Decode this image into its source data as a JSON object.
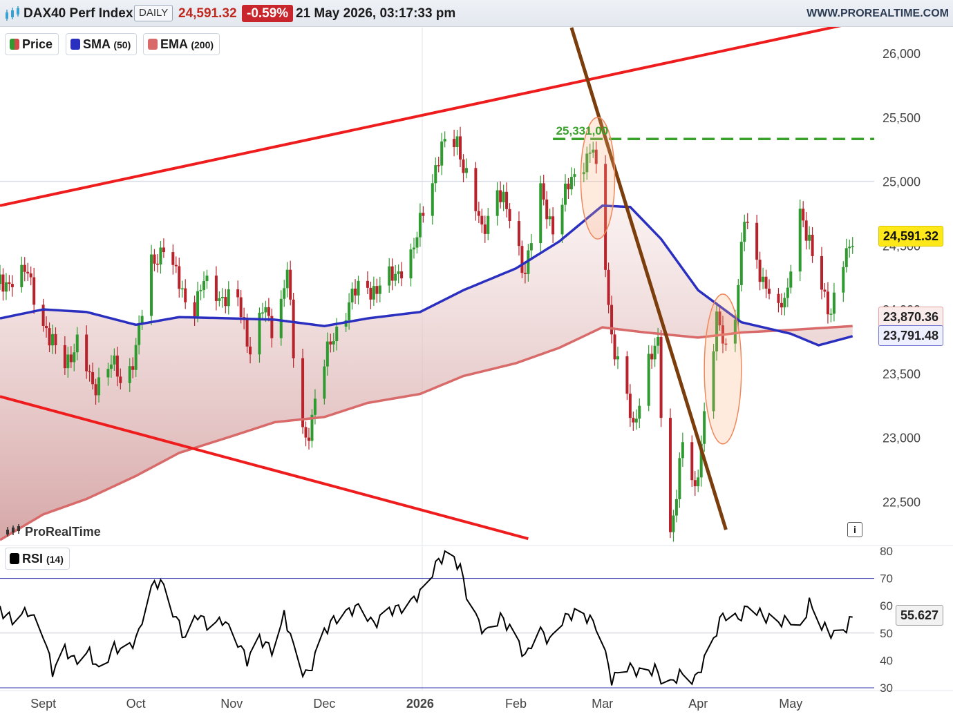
{
  "header": {
    "ticker": "DAX40 Perf Index",
    "timeframe": "DAILY",
    "last_price": "24,591.32",
    "change": "-0.59%",
    "datetime": "21 May 2026, 03:17:33 pm",
    "site": "WWW.PROREALTIME.COM"
  },
  "legend": {
    "price": "Price",
    "sma": "SMA",
    "sma_period": "(50)",
    "ema": "EMA",
    "ema_period": "(200)",
    "rsi": "RSI",
    "rsi_period": "(14)"
  },
  "brand": "ProRealTime",
  "info_label": "i",
  "price_tags": {
    "last": "24,591.32",
    "ema": "23,870.36",
    "sma": "23,791.48",
    "rsi": "55.627",
    "resistance": "25,331,00"
  },
  "colors": {
    "up": "#2f9a2f",
    "down": "#b8222a",
    "sma": "#2a2fbf",
    "ema": "#d86a6a",
    "trend_red": "#ee1c1c",
    "trend_brown": "#7a3d0b",
    "resistance": "#3aa02c",
    "highlight": "#ffb07a",
    "rsi_line": "#000000",
    "rsi_band": "#3a3fb0"
  },
  "chart_data": [
    {
      "type": "candlestick",
      "title": "DAX40 Perf Index",
      "y_ticks": [
        "22,500",
        "23,000",
        "23,500",
        "24,000",
        "24,500",
        "25,000",
        "25,500",
        "26,000"
      ],
      "y_tick_values": [
        22500,
        23000,
        23500,
        24000,
        24500,
        25000,
        25500,
        26000
      ],
      "ylim": [
        22200,
        26200
      ],
      "x_ticks": [
        "Sept",
        "Oct",
        "Nov",
        "Dec",
        "2026",
        "Feb",
        "Mar",
        "Apr",
        "May"
      ],
      "x_tick_dates": [
        "2025-09-01",
        "2025-10-01",
        "2025-11-01",
        "2025-12-01",
        "2026-01-01",
        "2026-02-01",
        "2026-03-01",
        "2026-04-01",
        "2026-05-01"
      ],
      "x_range": [
        "2025-08-18",
        "2026-05-28"
      ],
      "close_path": [
        [
          "2025-08-18",
          24200
        ],
        [
          "2025-08-27",
          24280
        ],
        [
          "2025-09-03",
          23750
        ],
        [
          "2025-09-08",
          23600
        ],
        [
          "2025-09-12",
          23720
        ],
        [
          "2025-09-17",
          23400
        ],
        [
          "2025-09-23",
          23580
        ],
        [
          "2025-09-27",
          23400
        ],
        [
          "2025-10-01",
          23700
        ],
        [
          "2025-10-06",
          24350
        ],
        [
          "2025-10-10",
          24500
        ],
        [
          "2025-10-14",
          24250
        ],
        [
          "2025-10-19",
          23980
        ],
        [
          "2025-10-23",
          24200
        ],
        [
          "2025-10-29",
          24100
        ],
        [
          "2025-11-03",
          24050
        ],
        [
          "2025-11-07",
          23700
        ],
        [
          "2025-11-11",
          24000
        ],
        [
          "2025-11-15",
          23800
        ],
        [
          "2025-11-19",
          24350
        ],
        [
          "2025-11-22",
          23250
        ],
        [
          "2025-11-25",
          22970
        ],
        [
          "2025-11-30",
          23500
        ],
        [
          "2025-12-04",
          23800
        ],
        [
          "2025-12-09",
          24050
        ],
        [
          "2025-12-13",
          24200
        ],
        [
          "2025-12-18",
          24150
        ],
        [
          "2025-12-24",
          24280
        ],
        [
          "2025-12-30",
          24450
        ],
        [
          "2026-01-03",
          24900
        ],
        [
          "2026-01-08",
          25250
        ],
        [
          "2026-01-13",
          25320
        ],
        [
          "2026-01-17",
          24950
        ],
        [
          "2026-01-21",
          24600
        ],
        [
          "2026-01-26",
          24950
        ],
        [
          "2026-01-30",
          24700
        ],
        [
          "2026-02-04",
          24300
        ],
        [
          "2026-02-09",
          24900
        ],
        [
          "2026-02-13",
          24650
        ],
        [
          "2026-02-18",
          24950
        ],
        [
          "2026-02-22",
          25150
        ],
        [
          "2026-02-26",
          25250
        ],
        [
          "2026-03-01",
          24600
        ],
        [
          "2026-03-04",
          23800
        ],
        [
          "2026-03-08",
          23400
        ],
        [
          "2026-03-11",
          23050
        ],
        [
          "2026-03-15",
          23600
        ],
        [
          "2026-03-19",
          23700
        ],
        [
          "2026-03-21",
          22700
        ],
        [
          "2026-03-23",
          22250
        ],
        [
          "2026-03-27",
          22950
        ],
        [
          "2026-03-31",
          22550
        ],
        [
          "2026-04-03",
          23200
        ],
        [
          "2026-04-07",
          23900
        ],
        [
          "2026-04-10",
          23700
        ],
        [
          "2026-04-13",
          24000
        ],
        [
          "2026-04-16",
          24700
        ],
        [
          "2026-04-20",
          24350
        ],
        [
          "2026-04-24",
          24150
        ],
        [
          "2026-04-27",
          23950
        ],
        [
          "2026-04-30",
          24150
        ],
        [
          "2026-05-03",
          24900
        ],
        [
          "2026-05-06",
          24550
        ],
        [
          "2026-05-10",
          24300
        ],
        [
          "2026-05-14",
          23950
        ],
        [
          "2026-05-18",
          24350
        ],
        [
          "2026-05-21",
          24591
        ]
      ],
      "sma_50": [
        [
          "2025-08-18",
          23930
        ],
        [
          "2025-09-01",
          24000
        ],
        [
          "2025-09-15",
          23980
        ],
        [
          "2025-10-01",
          23880
        ],
        [
          "2025-10-15",
          23940
        ],
        [
          "2025-11-01",
          23930
        ],
        [
          "2025-11-15",
          23920
        ],
        [
          "2025-12-01",
          23870
        ],
        [
          "2025-12-15",
          23930
        ],
        [
          "2026-01-01",
          23980
        ],
        [
          "2026-01-15",
          24150
        ],
        [
          "2026-02-01",
          24320
        ],
        [
          "2026-02-15",
          24530
        ],
        [
          "2026-03-01",
          24810
        ],
        [
          "2026-03-10",
          24800
        ],
        [
          "2026-03-20",
          24550
        ],
        [
          "2026-04-01",
          24150
        ],
        [
          "2026-04-15",
          23900
        ],
        [
          "2026-05-01",
          23810
        ],
        [
          "2026-05-10",
          23720
        ],
        [
          "2026-05-21",
          23791
        ]
      ],
      "ema_200": [
        [
          "2025-08-18",
          22200
        ],
        [
          "2025-09-01",
          22400
        ],
        [
          "2025-09-15",
          22520
        ],
        [
          "2025-10-01",
          22700
        ],
        [
          "2025-10-15",
          22880
        ],
        [
          "2025-11-01",
          23010
        ],
        [
          "2025-11-15",
          23120
        ],
        [
          "2025-12-01",
          23160
        ],
        [
          "2025-12-15",
          23270
        ],
        [
          "2026-01-01",
          23340
        ],
        [
          "2026-01-15",
          23480
        ],
        [
          "2026-02-01",
          23580
        ],
        [
          "2026-02-15",
          23700
        ],
        [
          "2026-03-01",
          23860
        ],
        [
          "2026-03-15",
          23820
        ],
        [
          "2026-04-01",
          23780
        ],
        [
          "2026-04-15",
          23820
        ],
        [
          "2026-05-01",
          23840
        ],
        [
          "2026-05-21",
          23870
        ]
      ],
      "trendlines": [
        {
          "kind": "upper-channel",
          "from": [
            "2025-08-18",
            24810
          ],
          "to": [
            "2026-05-20",
            26230
          ]
        },
        {
          "kind": "lower-channel",
          "from": [
            "2025-08-18",
            23320
          ],
          "to": [
            "2026-02-05",
            22210
          ]
        },
        {
          "kind": "downtrend",
          "from": [
            "2026-02-19",
            26200
          ],
          "to": [
            "2026-04-10",
            22280
          ]
        }
      ],
      "resistance_level": 25331,
      "highlight_zones": [
        {
          "date_range": [
            "2026-02-22",
            "2026-03-05"
          ],
          "value_range": [
            24550,
            25500
          ]
        },
        {
          "date_range": [
            "2026-04-03",
            "2026-04-15"
          ],
          "value_range": [
            22950,
            24120
          ]
        }
      ],
      "last_value": 24591.32,
      "sma_value": 23791.48,
      "ema_value": 23870.36
    },
    {
      "type": "line",
      "title": "RSI",
      "series": [
        {
          "name": "RSI",
          "values_path": [
            [
              "2025-08-18",
              58
            ],
            [
              "2025-08-22",
              55
            ],
            [
              "2025-08-27",
              58
            ],
            [
              "2025-09-01",
              50
            ],
            [
              "2025-09-04",
              36
            ],
            [
              "2025-09-08",
              44
            ],
            [
              "2025-09-11",
              40
            ],
            [
              "2025-09-16",
              43
            ],
            [
              "2025-09-19",
              36
            ],
            [
              "2025-09-24",
              45
            ],
            [
              "2025-09-28",
              43
            ],
            [
              "2025-10-02",
              50
            ],
            [
              "2025-10-05",
              66
            ],
            [
              "2025-10-09",
              69
            ],
            [
              "2025-10-13",
              58
            ],
            [
              "2025-10-17",
              48
            ],
            [
              "2025-10-21",
              57
            ],
            [
              "2025-10-25",
              52
            ],
            [
              "2025-10-29",
              55
            ],
            [
              "2025-11-03",
              47
            ],
            [
              "2025-11-06",
              40
            ],
            [
              "2025-11-10",
              48
            ],
            [
              "2025-11-15",
              43
            ],
            [
              "2025-11-18",
              57
            ],
            [
              "2025-11-23",
              37
            ],
            [
              "2025-11-26",
              35
            ],
            [
              "2025-11-30",
              49
            ],
            [
              "2025-12-04",
              55
            ],
            [
              "2025-12-09",
              58
            ],
            [
              "2025-12-13",
              60
            ],
            [
              "2025-12-17",
              53
            ],
            [
              "2025-12-21",
              58
            ],
            [
              "2025-12-28",
              60
            ],
            [
              "2026-01-02",
              66
            ],
            [
              "2026-01-06",
              75
            ],
            [
              "2026-01-10",
              80
            ],
            [
              "2026-01-14",
              74
            ],
            [
              "2026-01-17",
              60
            ],
            [
              "2026-01-22",
              50
            ],
            [
              "2026-01-27",
              56
            ],
            [
              "2026-02-01",
              49
            ],
            [
              "2026-02-04",
              41
            ],
            [
              "2026-02-08",
              52
            ],
            [
              "2026-02-12",
              47
            ],
            [
              "2026-02-16",
              55
            ],
            [
              "2026-02-21",
              58
            ],
            [
              "2026-02-25",
              55
            ],
            [
              "2026-02-28",
              52
            ],
            [
              "2026-03-02",
              42
            ],
            [
              "2026-03-04",
              33
            ],
            [
              "2026-03-09",
              38
            ],
            [
              "2026-03-14",
              35
            ],
            [
              "2026-03-18",
              37
            ],
            [
              "2026-03-22",
              30
            ],
            [
              "2026-03-26",
              35
            ],
            [
              "2026-03-31",
              33
            ],
            [
              "2026-04-03",
              40
            ],
            [
              "2026-04-06",
              48
            ],
            [
              "2026-04-09",
              57
            ],
            [
              "2026-04-14",
              55
            ],
            [
              "2026-04-18",
              61
            ],
            [
              "2026-04-22",
              56
            ],
            [
              "2026-04-27",
              54
            ],
            [
              "2026-05-01",
              55
            ],
            [
              "2026-05-04",
              51
            ],
            [
              "2026-05-07",
              61
            ],
            [
              "2026-05-11",
              53
            ],
            [
              "2026-05-15",
              49
            ],
            [
              "2026-05-19",
              52
            ],
            [
              "2026-05-21",
              56
            ]
          ]
        }
      ],
      "y_ticks": [
        "30",
        "40",
        "50",
        "60",
        "70",
        "80"
      ],
      "y_tick_values": [
        30,
        40,
        50,
        60,
        70,
        80
      ],
      "ylim": [
        29,
        82
      ],
      "bands": [
        30,
        70
      ],
      "last_value": 55.627
    }
  ]
}
